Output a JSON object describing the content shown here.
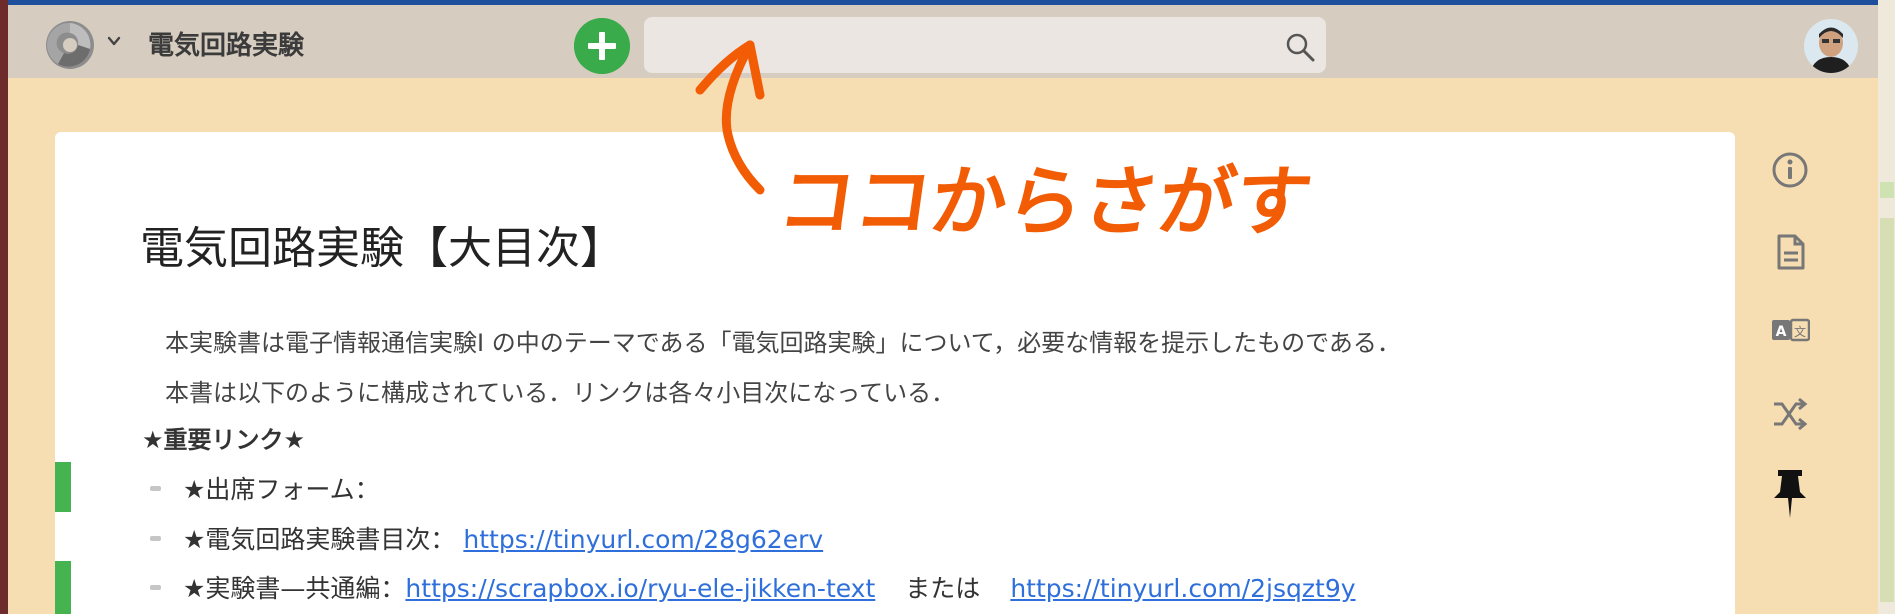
{
  "header": {
    "project_title": "電気回路実験",
    "search_placeholder": "",
    "icons": [
      "logo-icon",
      "chevron-down-icon",
      "plus-icon",
      "search-icon",
      "avatar"
    ]
  },
  "annotation": {
    "text": "ココからさがす"
  },
  "page": {
    "title": "電気回路実験【大目次】",
    "paragraph_1": "本実験書は電子情報通信実験I の中のテーマである「電気回路実験」について，必要な情報を提示したものである．",
    "paragraph_2": "本書は以下のように構成されている．リンクは各々小目次になっている．",
    "important_heading": "★重要リンク★",
    "items": [
      {
        "label": "★出席フォーム："
      },
      {
        "label": "★電気回路実験書目次：",
        "link1": "https://tinyurl.com/28g62erv"
      },
      {
        "label": "★実験書—共通編：",
        "link1": "https://scrapbox.io/ryu-ele-jikken-text",
        "middle": "または",
        "link2": "https://tinyurl.com/2jsqzt9y"
      }
    ]
  },
  "sidebar_icons": [
    "info-icon",
    "document-icon",
    "translate-icon",
    "shuffle-icon",
    "pin-icon"
  ],
  "colors": {
    "background": "#f6deb2",
    "navbar": "#d6ccc0",
    "accent_green": "#3aab4a",
    "annotation_orange": "#f25c05",
    "link_blue": "#2e6fdb"
  }
}
